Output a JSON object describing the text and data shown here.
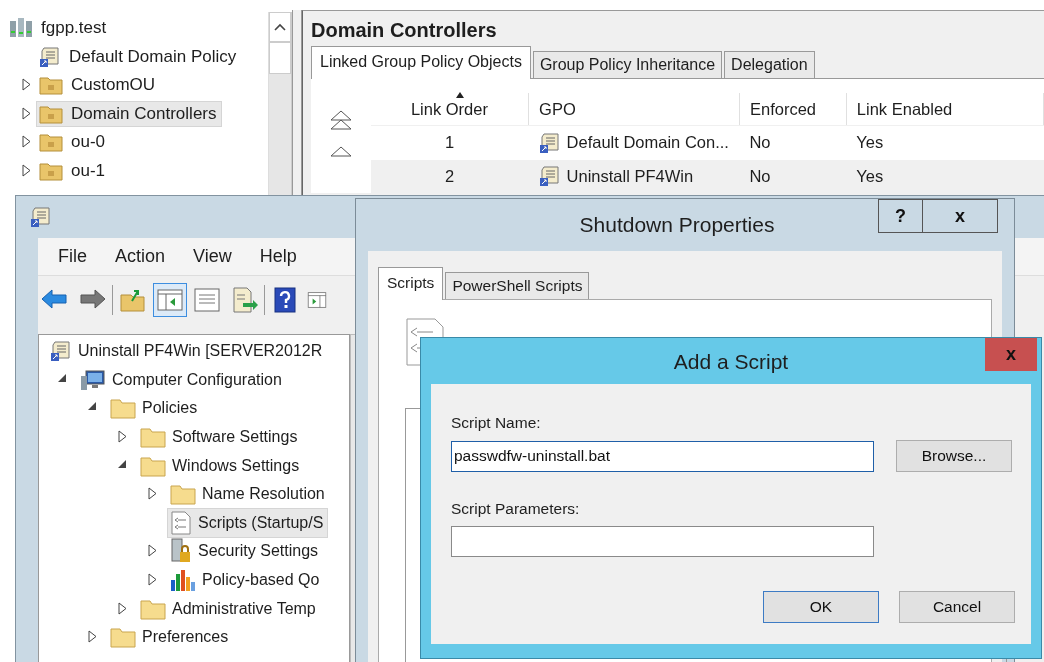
{
  "gpmc_tree": {
    "items": [
      {
        "label": "fgpp.test",
        "kind": "domain",
        "selected": false,
        "children": [
          {
            "label": "Default Domain Policy",
            "kind": "gpo",
            "selected": false
          },
          {
            "label": "CustomOU",
            "kind": "ou",
            "expanded": false,
            "selected": false
          },
          {
            "label": "Domain Controllers",
            "kind": "ou",
            "expanded": false,
            "selected": true
          },
          {
            "label": "ou-0",
            "kind": "ou",
            "expanded": false,
            "selected": false
          },
          {
            "label": "ou-1",
            "kind": "ou",
            "expanded": false,
            "selected": false
          }
        ]
      }
    ]
  },
  "gpmc_details": {
    "title": "Domain Controllers",
    "tabs": [
      {
        "label": "Linked Group Policy Objects",
        "selected": true
      },
      {
        "label": "Group Policy Inheritance",
        "selected": false
      },
      {
        "label": "Delegation",
        "selected": false
      }
    ],
    "table": {
      "columns": [
        {
          "label": "Link Order",
          "sorted": true
        },
        {
          "label": "GPO",
          "sorted": false
        },
        {
          "label": "Enforced",
          "sorted": false
        },
        {
          "label": "Link Enabled",
          "sorted": false
        }
      ],
      "rows": [
        {
          "cells": [
            "1",
            "Default Domain Con...",
            "No",
            "Yes"
          ],
          "selected": false
        },
        {
          "cells": [
            "2",
            "Uninstall PF4Win",
            "No",
            "Yes"
          ],
          "selected": true
        }
      ]
    }
  },
  "editor": {
    "menu": [
      "File",
      "Action",
      "View",
      "Help"
    ],
    "toolbar": [
      {
        "kind": "back",
        "pressed": false
      },
      {
        "kind": "forward",
        "pressed": false
      },
      {
        "kind": "separator"
      },
      {
        "kind": "up",
        "pressed": false
      },
      {
        "kind": "tree",
        "pressed": true
      },
      {
        "kind": "properties",
        "pressed": false
      },
      {
        "kind": "export",
        "pressed": false
      },
      {
        "kind": "separator"
      },
      {
        "kind": "help",
        "pressed": false
      },
      {
        "kind": "action-pane",
        "pressed": false
      }
    ],
    "tree": {
      "items": [
        {
          "label": "Uninstall PF4Win [SERVER2012R",
          "kind": "gpo",
          "selected": false,
          "children": [
            {
              "label": "Computer Configuration",
              "kind": "computer",
              "expanded": true,
              "selected": false,
              "children": [
                {
                  "label": "Policies",
                  "kind": "folder",
                  "expanded": true,
                  "selected": false,
                  "children": [
                    {
                      "label": "Software Settings",
                      "kind": "folder",
                      "expanded": false,
                      "selected": false
                    },
                    {
                      "label": "Windows Settings",
                      "kind": "folder",
                      "expanded": true,
                      "selected": false,
                      "children": [
                        {
                          "label": "Name Resolution",
                          "kind": "folder",
                          "expanded": false,
                          "selected": false
                        },
                        {
                          "label": "Scripts (Startup/S",
                          "kind": "script",
                          "selected": true
                        },
                        {
                          "label": "Security Settings",
                          "kind": "security",
                          "expanded": false,
                          "selected": false
                        },
                        {
                          "label": "Policy-based Qo",
                          "kind": "qos",
                          "expanded": false,
                          "selected": false
                        }
                      ]
                    },
                    {
                      "label": "Administrative Temp",
                      "kind": "folder",
                      "expanded": false,
                      "selected": false
                    }
                  ]
                },
                {
                  "label": "Preferences",
                  "kind": "folder",
                  "expanded": false,
                  "selected": false
                }
              ]
            }
          ]
        }
      ]
    }
  },
  "shutdown_dialog": {
    "title": "Shutdown Properties",
    "help_button": "?",
    "close_button": "x",
    "tabs": [
      {
        "label": "Scripts",
        "selected": true
      },
      {
        "label": "PowerShell Scripts",
        "selected": false
      }
    ]
  },
  "add_script_dialog": {
    "title": "Add a Script",
    "close_button": "x",
    "fields": [
      {
        "label": "Script Name:",
        "value": "passwdfw-uninstall.bat",
        "focused": true
      },
      {
        "label": "Script Parameters:",
        "focused": false
      }
    ],
    "browse_button": "Browse...",
    "buttons": [
      {
        "label": "OK",
        "default": true
      },
      {
        "label": "Cancel",
        "default": false
      }
    ]
  }
}
